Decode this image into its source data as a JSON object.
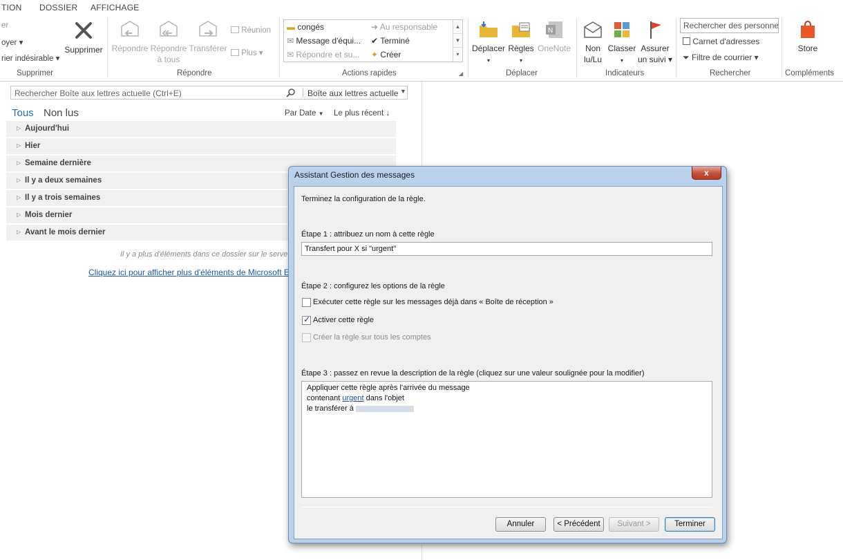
{
  "menu": {
    "items": [
      "TION",
      "DOSSIER",
      "AFFICHAGE"
    ]
  },
  "ribbon": {
    "delete_group": {
      "label": "Supprimer",
      "items": [
        "er",
        "oyer",
        "rier indésirable"
      ],
      "delete_button": "Supprimer"
    },
    "reply_group": {
      "label": "Répondre",
      "reply": "Répondre",
      "reply_all_1": "Répondre",
      "reply_all_2": "à tous",
      "forward": "Transférer",
      "meeting": "Réunion",
      "more": "Plus"
    },
    "quick_steps": {
      "label": "Actions rapides",
      "items": [
        "congés",
        "Message d'équi...",
        "Répondre et su...",
        "Au responsable",
        "Terminé",
        "Créer"
      ]
    },
    "move_group": {
      "label": "Déplacer",
      "move": "Déplacer",
      "rules": "Règles",
      "onenote": "OneNote"
    },
    "tags_group": {
      "label": "Indicateurs",
      "unread_1": "Non",
      "unread_2": "lu/Lu",
      "categorize": "Classer",
      "followup_1": "Assurer",
      "followup_2": "un suivi"
    },
    "find_group": {
      "label": "Rechercher",
      "search_people": "Rechercher des personnes",
      "address_book": "Carnet d'adresses",
      "filter_mail": "Filtre de courrier"
    },
    "addins_group": {
      "label": "Compléments",
      "store": "Store"
    }
  },
  "mail_list": {
    "search_placeholder": "Rechercher Boîte aux lettres actuelle (Ctrl+E)",
    "search_scope": "Boîte aux lettres actuelle",
    "filter_all": "Tous",
    "filter_unread": "Non lus",
    "sort_by": "Par Date",
    "sort_order": "Le plus récent",
    "groups": [
      "Aujourd'hui",
      "Hier",
      "Semaine dernière",
      "Il y a deux semaines",
      "Il y a trois semaines",
      "Mois dernier",
      "Avant le mois dernier"
    ],
    "more_note": "Il y a plus d'éléments dans ce dossier sur le serveur",
    "more_link": "Cliquez ici pour afficher plus d'éléments de Microsoft Ex"
  },
  "dialog": {
    "title": "Assistant Gestion des messages",
    "close_label": "x",
    "intro": "Terminez la configuration de la règle.",
    "step1": "Étape 1 : attribuez un nom à cette règle",
    "rule_name": "Transfert pour X si \"urgent\"",
    "step2": "Étape 2 : configurez les options de la règle",
    "option_run_now": "Exécuter cette règle sur les messages déjà dans « Boîte de réception »",
    "option_run_now_checked": false,
    "option_enable": "Activer cette règle",
    "option_enable_checked": true,
    "option_all_accounts": "Créer la règle sur tous les comptes",
    "option_all_accounts_checked": false,
    "step3": "Étape 3 : passez en revue la description de la règle (cliquez sur une valeur soulignée pour la modifier)",
    "desc_line1": "Appliquer cette règle après l'arrivée du message",
    "desc_line2_pre": "contenant",
    "desc_line2_link": "urgent",
    "desc_line2_post": "dans l'objet",
    "desc_line3": "le transférer à",
    "buttons": {
      "cancel": "Annuler",
      "previous": "< Précédent",
      "next": "Suivant >",
      "finish": "Terminer"
    }
  },
  "colors": {
    "accent": "#2b6cb0",
    "dialog_frame": "#b9d1ea",
    "close_button": "#c44f3a",
    "link": "#1e5aa8"
  }
}
